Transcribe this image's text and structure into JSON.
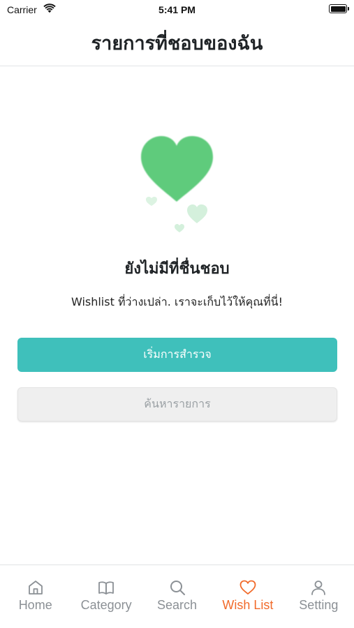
{
  "status_bar": {
    "carrier": "Carrier",
    "time": "5:41 PM"
  },
  "header": {
    "title": "รายการที่ชอบของฉัน"
  },
  "empty_state": {
    "title": "ยังไม่มีที่ชื่นชอบ",
    "message": "Wishlist ที่ว่างเปล่า. เราจะเก็บไว้ให้คุณที่นี่!",
    "illustration": "green-hearts-icon"
  },
  "actions": {
    "primary_label": "เริ่มการสำรวจ",
    "secondary_label": "ค้นหารายการ"
  },
  "tabs": [
    {
      "label": "Home",
      "icon": "home-icon",
      "active": false
    },
    {
      "label": "Category",
      "icon": "book-icon",
      "active": false
    },
    {
      "label": "Search",
      "icon": "search-icon",
      "active": false
    },
    {
      "label": "Wish List",
      "icon": "heart-icon",
      "active": true
    },
    {
      "label": "Setting",
      "icon": "user-icon",
      "active": false
    }
  ],
  "colors": {
    "accent": "#3fc0bb",
    "active_tab": "#f16a2a",
    "inactive_tab": "#8b9095",
    "heart": "#5fcb7c"
  }
}
